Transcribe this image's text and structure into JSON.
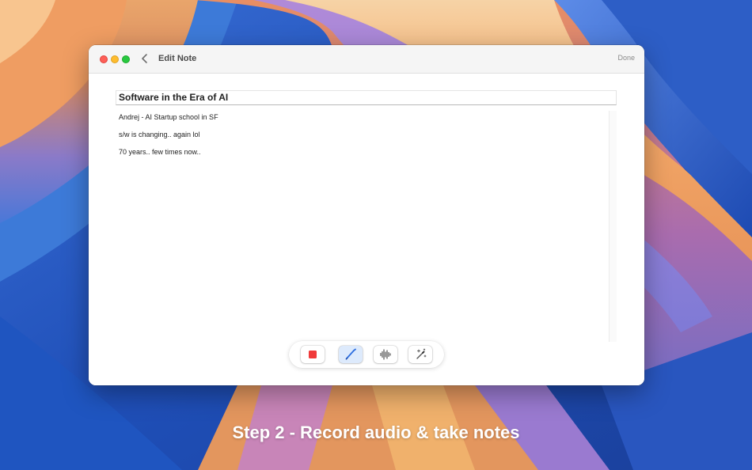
{
  "window": {
    "title": "Edit Note",
    "done_label": "Done"
  },
  "note": {
    "title": "Software in the Era of AI",
    "lines": [
      "Andrej - AI Startup school in SF",
      "s/w is changing.. again lol",
      "70 years.. few times now.."
    ]
  },
  "toolbar": {
    "tools": [
      {
        "name": "stop-recording",
        "icon": "stop-square-icon",
        "active": false
      },
      {
        "name": "pen",
        "icon": "pencil-icon",
        "active": true
      },
      {
        "name": "audio-waveform",
        "icon": "waveform-icon",
        "active": false
      },
      {
        "name": "magic",
        "icon": "magic-wand-icon",
        "active": false
      }
    ]
  },
  "caption": "Step 2 - Record audio & take notes",
  "colors": {
    "record_red": "#f03a3a",
    "active_blue": "#2f6fe0",
    "active_bg": "#ddeafc"
  }
}
